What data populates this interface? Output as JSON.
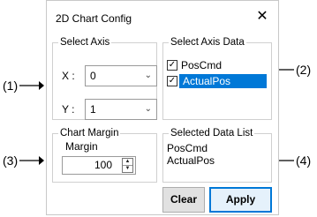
{
  "dialog": {
    "title": "2D Chart Config",
    "close_glyph": "✕"
  },
  "select_axis": {
    "legend": "Select Axis",
    "x_label": "X :",
    "x_value": "0",
    "y_label": "Y :",
    "y_value": "1"
  },
  "select_axis_data": {
    "legend": "Select Axis Data",
    "items": [
      {
        "label": "PosCmd",
        "checked": true,
        "selected": false
      },
      {
        "label": "ActualPos",
        "checked": true,
        "selected": true
      }
    ]
  },
  "chart_margin": {
    "legend": "Chart Margin",
    "label": "Margin",
    "value": "100"
  },
  "selected_data_list": {
    "legend": "Selected Data List",
    "items": [
      "PosCmd",
      "ActualPos"
    ]
  },
  "buttons": {
    "clear": "Clear",
    "apply": "Apply"
  },
  "callouts": {
    "c1": "(1)",
    "c2": "(2)",
    "c3": "(3)",
    "c4": "(4)"
  },
  "colors": {
    "selection": "#0078d7"
  }
}
